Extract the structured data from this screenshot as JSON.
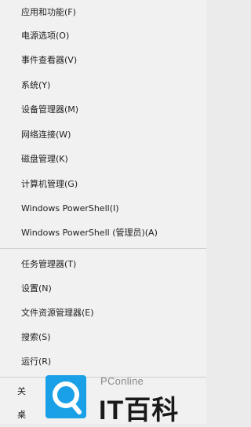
{
  "menu": {
    "items": [
      {
        "label": "应用和功能(F)"
      },
      {
        "label": "电源选项(O)"
      },
      {
        "label": "事件查看器(V)"
      },
      {
        "label": "系统(Y)"
      },
      {
        "label": "设备管理器(M)"
      },
      {
        "label": "网络连接(W)"
      },
      {
        "label": "磁盘管理(K)"
      },
      {
        "label": "计算机管理(G)"
      },
      {
        "label": "Windows PowerShell(I)"
      },
      {
        "label": "Windows PowerShell (管理员)(A)"
      },
      {
        "label": "任务管理器(T)"
      },
      {
        "label": "设置(N)"
      },
      {
        "label": "文件资源管理器(E)"
      },
      {
        "label": "搜索(S)"
      },
      {
        "label": "运行(R)"
      }
    ],
    "partial_items": [
      {
        "label": "关"
      },
      {
        "label": "桌"
      }
    ]
  },
  "watermark": {
    "brand_small": "PConline",
    "brand_big": "IT百科",
    "colors": {
      "accent": "#1aa0e6"
    }
  }
}
